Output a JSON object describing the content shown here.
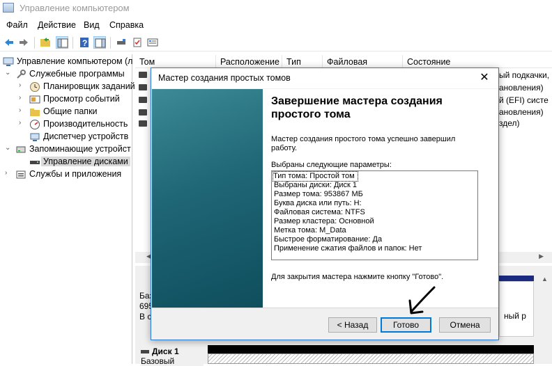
{
  "window": {
    "title": "Управление компьютером"
  },
  "menu": [
    "Файл",
    "Действие",
    "Вид",
    "Справка"
  ],
  "tree": {
    "root": "Управление компьютером (л",
    "items": [
      {
        "label": "Служебные программы"
      },
      {
        "label": "Планировщик заданий"
      },
      {
        "label": "Просмотр событий"
      },
      {
        "label": "Общие папки"
      },
      {
        "label": "Производительность"
      },
      {
        "label": "Диспетчер устройств"
      },
      {
        "label": "Запоминающие устройст"
      },
      {
        "label": "Управление дисками"
      },
      {
        "label": "Службы и приложения"
      }
    ]
  },
  "volume_list": {
    "columns": [
      "Том",
      "Расположение",
      "Тип",
      "Файловая система",
      "Состояние"
    ],
    "state_fragments": [
      "ый подкачки,",
      "ановления)",
      "й (EFI) систе",
      "ановления)",
      "здел)"
    ]
  },
  "disk_panel": {
    "disk0": {
      "lines": [
        "Баз",
        "695",
        "В с"
      ]
    },
    "disk0_right": "ный р",
    "disk1": {
      "name": "Диск 1",
      "type": "Базовый"
    }
  },
  "wizard": {
    "title": "Мастер создания простых томов",
    "close_glyph": "✕",
    "heading": "Завершение мастера создания простого тома",
    "description": "Мастер создания простого тома успешно завершил работу.",
    "params_label": "Выбраны следующие параметры:",
    "params": [
      "Тип тома: Простой том",
      "Выбраны диски: Диск 1",
      "Размер тома: 953867 МБ",
      "Буква диска или путь: H:",
      "Файловая система: NTFS",
      "Размер кластера: Основной",
      "Метка тома: M_Data",
      "Быстрое форматирование: Да",
      "Применение сжатия файлов и папок: Нет"
    ],
    "close_note": "Для закрытия мастера нажмите кнопку \"Готово\".",
    "buttons": {
      "back": "< Назад",
      "finish": "Готово",
      "cancel": "Отмена"
    }
  }
}
